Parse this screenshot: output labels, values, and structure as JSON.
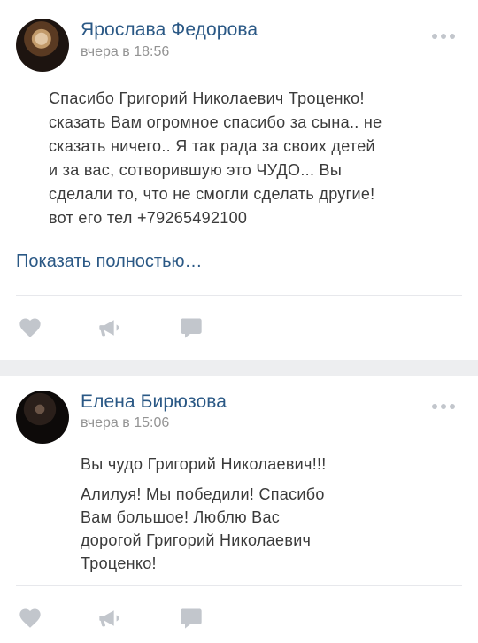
{
  "posts": [
    {
      "author": "Ярослава Федорова",
      "time": "вчера в 18:56",
      "text_lines": [
        "Спасибо Григорий Николаевич Троценко!",
        "сказать Вам огромное спасибо за сына.. не",
        "сказать ничего.. Я так рада за своих детей",
        "и за вас, сотворившую это ЧУДО... Вы",
        "сделали то, что не смогли сделать другие!",
        "вот его тел +79265492100"
      ],
      "show_more": "Показать полностью…"
    },
    {
      "author": "Елена Бирюзова",
      "time": "вчера в 15:06",
      "first_line": "Вы чудо Григорий Николаевич!!!",
      "text_lines": [
        "Алилуя! Мы победили! Спасибо",
        "Вам большое! Люблю Вас",
        "дорогой Григорий Николаевич",
        "Троценко!"
      ]
    }
  ],
  "icons": {
    "like": "heart-icon",
    "share": "megaphone-icon",
    "comment": "comment-icon",
    "more": "more-dots-icon"
  },
  "colors": {
    "author_link": "#2a5885",
    "icon": "#c2c6cc",
    "background": "#edeef0"
  }
}
